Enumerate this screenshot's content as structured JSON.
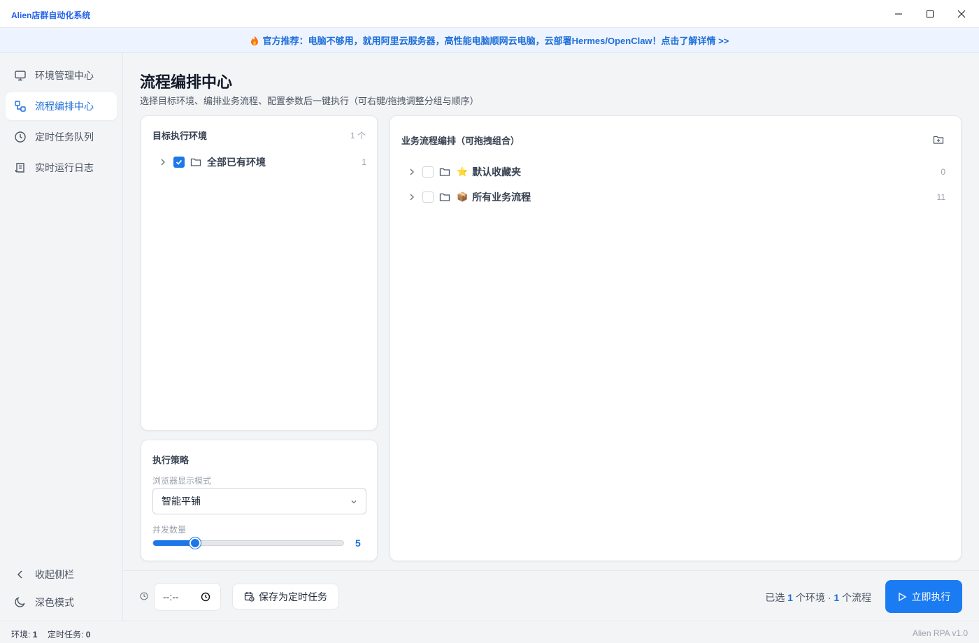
{
  "window": {
    "title": "Alien店群自动化系统"
  },
  "banner": {
    "text": "官方推荐：电脑不够用，就用阿里云服务器，高性能电脑顺网云电脑，云部署Hermes/OpenClaw！点击了解详情 >>"
  },
  "sidebar": {
    "items": [
      {
        "label": "环境管理中心",
        "icon": "monitor-icon"
      },
      {
        "label": "流程编排中心",
        "icon": "flow-icon"
      },
      {
        "label": "定时任务队列",
        "icon": "clock-icon"
      },
      {
        "label": "实时运行日志",
        "icon": "scroll-icon"
      }
    ],
    "collapse_label": "收起侧栏",
    "dark_mode_label": "深色模式"
  },
  "page": {
    "title": "流程编排中心",
    "subtitle": "选择目标环境、编排业务流程、配置参数后一键执行（可右键/拖拽调整分组与顺序）"
  },
  "env_panel": {
    "title": "目标执行环境",
    "count_label": "1 个",
    "items": [
      {
        "label": "全部已有环境",
        "count": "1",
        "checked": true
      }
    ]
  },
  "strategy": {
    "title": "执行策略",
    "browser_mode_label": "浏览器显示模式",
    "browser_mode_value": "智能平铺",
    "concurrency_label": "并发数量",
    "concurrency_value": "5",
    "concurrency_fraction": 0.22
  },
  "flow_panel": {
    "title": "业务流程编排（可拖拽组合）",
    "items": [
      {
        "emoji": "⭐",
        "label": "默认收藏夹",
        "count": "0",
        "checked": false
      },
      {
        "emoji": "📦",
        "label": "所有业务流程",
        "count": "11",
        "checked": false
      }
    ]
  },
  "footer": {
    "time_placeholder": "--:--",
    "save_schedule_label": "保存为定时任务",
    "summary_prefix": "已选",
    "env_count": "1",
    "env_unit": "个环境 ·",
    "flow_count": "1",
    "flow_unit": "个流程",
    "run_label": "立即执行"
  },
  "statusbar": {
    "env_label": "环境:",
    "env_value": "1",
    "task_label": "定时任务:",
    "task_value": "0",
    "version": "Alien RPA v1.0"
  },
  "colors": {
    "accent": "#1a7bf2",
    "banner_text": "#1d6fd8"
  }
}
